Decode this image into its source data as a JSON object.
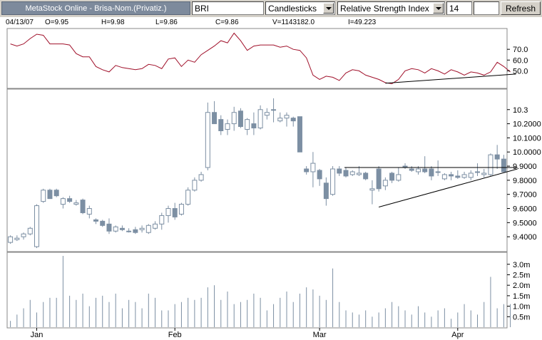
{
  "toolbar": {
    "title": "MetaStock Online - Brisa-Nom.(Privatiz.)",
    "symbol": "BRI",
    "chart_style": "Candlesticks",
    "indicator": "Relative Strength Index",
    "period": "14",
    "extra": "",
    "refresh_label": "Refresh"
  },
  "readout": {
    "date": "04/13/07",
    "open": "O=9.95",
    "high": "H=9.98",
    "low": "L=9.86",
    "close": "C=9.86",
    "volume": "V=1143182.0",
    "indicator": "I=49.223"
  },
  "colors": {
    "rsi_line": "#a0102a",
    "candle": "#7c8fa3",
    "volume": "#7c8fa3",
    "toolbar_bg": "#d4d0c8",
    "grid_border": "#888888"
  },
  "chart_data": [
    {
      "type": "line",
      "name": "rsi",
      "values": [
        75,
        73,
        75,
        80,
        84,
        83,
        75,
        75,
        75,
        74,
        66,
        63,
        63,
        54,
        51,
        49,
        55,
        53,
        52,
        51,
        52,
        56,
        55,
        52,
        61,
        62,
        54,
        60,
        58,
        65,
        69,
        73,
        78,
        76,
        85,
        78,
        69,
        73,
        74,
        74,
        74,
        72,
        73,
        70,
        69,
        62,
        46,
        42,
        45,
        44,
        41,
        48,
        51,
        50,
        46,
        44,
        42,
        39,
        38,
        42,
        50,
        52,
        51,
        48,
        52,
        50,
        47,
        51,
        49,
        46,
        49,
        48,
        46,
        49,
        58,
        54,
        49
      ],
      "ylim": [
        35,
        88
      ],
      "yticks": [
        "70.0",
        "60.0",
        "50.0"
      ],
      "trendline": [
        [
          57,
          38.5
        ],
        [
          76,
          47
        ]
      ]
    },
    {
      "type": "candlestick",
      "name": "price",
      "ohlc": [
        [
          9.36,
          9.41,
          9.35,
          9.4
        ],
        [
          9.38,
          9.41,
          9.37,
          9.39
        ],
        [
          9.4,
          9.43,
          9.38,
          9.42
        ],
        [
          9.42,
          9.47,
          9.41,
          9.46
        ],
        [
          9.33,
          9.63,
          9.32,
          9.62
        ],
        [
          9.65,
          9.74,
          9.64,
          9.73
        ],
        [
          9.73,
          9.74,
          9.67,
          9.67
        ],
        [
          9.73,
          9.74,
          9.68,
          9.69
        ],
        [
          9.63,
          9.68,
          9.6,
          9.67
        ],
        [
          9.67,
          9.69,
          9.64,
          9.65
        ],
        [
          9.63,
          9.66,
          9.62,
          9.64
        ],
        [
          9.66,
          9.67,
          9.56,
          9.57
        ],
        [
          9.56,
          9.62,
          9.53,
          9.6
        ],
        [
          9.52,
          9.53,
          9.49,
          9.51
        ],
        [
          9.51,
          9.52,
          9.47,
          9.48
        ],
        [
          9.49,
          9.53,
          9.42,
          9.44
        ],
        [
          9.44,
          9.48,
          9.43,
          9.47
        ],
        [
          9.46,
          9.48,
          9.44,
          9.45
        ],
        [
          9.44,
          9.46,
          9.43,
          9.44
        ],
        [
          9.45,
          9.47,
          9.42,
          9.43
        ],
        [
          9.45,
          9.48,
          9.43,
          9.46
        ],
        [
          9.43,
          9.49,
          9.42,
          9.48
        ],
        [
          9.46,
          9.51,
          9.45,
          9.49
        ],
        [
          9.49,
          9.57,
          9.45,
          9.55
        ],
        [
          9.55,
          9.62,
          9.5,
          9.6
        ],
        [
          9.6,
          9.64,
          9.52,
          9.54
        ],
        [
          9.56,
          9.64,
          9.55,
          9.63
        ],
        [
          9.63,
          9.75,
          9.62,
          9.73
        ],
        [
          9.73,
          9.82,
          9.72,
          9.8
        ],
        [
          9.8,
          9.86,
          9.79,
          9.84
        ],
        [
          9.89,
          10.35,
          9.87,
          10.28
        ],
        [
          10.28,
          10.36,
          10.2,
          10.2
        ],
        [
          10.23,
          10.26,
          10.12,
          10.15
        ],
        [
          10.16,
          10.23,
          10.12,
          10.2
        ],
        [
          10.2,
          10.32,
          10.15,
          10.28
        ],
        [
          10.29,
          10.31,
          10.17,
          10.18
        ],
        [
          10.16,
          10.24,
          10.12,
          10.23
        ],
        [
          10.2,
          10.28,
          10.12,
          10.17
        ],
        [
          10.17,
          10.33,
          10.16,
          10.3
        ],
        [
          10.26,
          10.31,
          10.23,
          10.28
        ],
        [
          10.3,
          10.38,
          10.21,
          10.3
        ],
        [
          10.22,
          10.28,
          10.21,
          10.24
        ],
        [
          10.24,
          10.28,
          10.18,
          10.26
        ],
        [
          10.24,
          10.25,
          10.18,
          10.22
        ],
        [
          10.25,
          10.25,
          10.0,
          10.0
        ],
        [
          9.88,
          9.9,
          9.84,
          9.86
        ],
        [
          9.86,
          10.0,
          9.75,
          9.92
        ],
        [
          9.87,
          9.88,
          9.76,
          9.81
        ],
        [
          9.78,
          9.82,
          9.62,
          9.67
        ],
        [
          9.7,
          9.9,
          9.69,
          9.88
        ],
        [
          9.88,
          9.9,
          9.83,
          9.85
        ],
        [
          9.87,
          9.89,
          9.82,
          9.83
        ],
        [
          9.84,
          9.87,
          9.83,
          9.86
        ],
        [
          9.84,
          9.9,
          9.83,
          9.85
        ],
        [
          9.85,
          9.86,
          9.8,
          9.81
        ],
        [
          9.73,
          9.8,
          9.63,
          9.74
        ],
        [
          9.88,
          9.9,
          9.72,
          9.74
        ],
        [
          9.76,
          9.82,
          9.73,
          9.8
        ],
        [
          9.85,
          9.86,
          9.78,
          9.8
        ],
        [
          9.8,
          9.89,
          9.79,
          9.84
        ],
        [
          9.9,
          9.92,
          9.88,
          9.89
        ],
        [
          9.88,
          9.9,
          9.86,
          9.87
        ],
        [
          9.86,
          9.9,
          9.84,
          9.88
        ],
        [
          9.88,
          9.97,
          9.85,
          9.86
        ],
        [
          9.88,
          9.9,
          9.8,
          9.83
        ],
        [
          9.86,
          9.94,
          9.83,
          9.86
        ],
        [
          9.81,
          9.85,
          9.8,
          9.84
        ],
        [
          9.84,
          9.86,
          9.8,
          9.83
        ],
        [
          9.83,
          9.87,
          9.81,
          9.82
        ],
        [
          9.82,
          9.86,
          9.81,
          9.84
        ],
        [
          9.82,
          9.87,
          9.8,
          9.85
        ],
        [
          9.86,
          9.92,
          9.83,
          9.86
        ],
        [
          9.84,
          9.88,
          9.82,
          9.85
        ],
        [
          9.84,
          9.99,
          9.83,
          9.98
        ],
        [
          9.98,
          10.05,
          9.88,
          9.95
        ],
        [
          9.95,
          9.98,
          9.86,
          9.86
        ]
      ],
      "ylim": [
        9.31,
        10.43
      ],
      "yticks": [
        "10.3",
        "10.2000",
        "10.1000",
        "10.0000",
        "9.9000",
        "9.8000",
        "9.7000",
        "9.6000",
        "9.5000",
        "9.4000"
      ],
      "resistance": [
        [
          51,
          9.89
        ],
        [
          76,
          9.89
        ]
      ],
      "support": [
        [
          56,
          9.61
        ],
        [
          76,
          9.88
        ]
      ]
    },
    {
      "type": "bar",
      "name": "volume",
      "values": [
        0.3,
        0.6,
        0.9,
        1.3,
        0.7,
        1.2,
        1.4,
        1.4,
        3.4,
        1.5,
        1.3,
        1.6,
        1.0,
        1.4,
        1.5,
        1.2,
        1.6,
        0.9,
        1.3,
        1.2,
        0.9,
        1.6,
        1.4,
        0.8,
        0.8,
        1.1,
        1.2,
        1.4,
        1.3,
        1.4,
        1.9,
        2.0,
        1.3,
        1.7,
        1.1,
        1.2,
        1.3,
        1.6,
        1.4,
        0.8,
        1.1,
        1.4,
        1.7,
        1.2,
        1.6,
        1.9,
        1.8,
        1.5,
        1.3,
        2.8,
        1.2,
        0.8,
        0.7,
        0.6,
        0.8,
        0.5,
        0.7,
        0.9,
        1.2,
        1.0,
        0.8,
        0.6,
        1.0,
        0.7,
        0.5,
        0.8,
        0.9,
        0.4,
        0.7,
        1.1,
        0.8,
        0.6,
        1.2,
        2.4,
        0.9,
        1.1,
        1.1
      ],
      "ylim": [
        0,
        3.4
      ],
      "yticks": [
        "3.0m",
        "2.5m",
        "2.0m",
        "1.5m",
        "1.0m",
        "0.5m"
      ]
    }
  ],
  "x_axis": {
    "labels": [
      "Jan",
      "Feb",
      "Mar",
      "Apr"
    ],
    "label_index": [
      4,
      25,
      47,
      68
    ]
  }
}
